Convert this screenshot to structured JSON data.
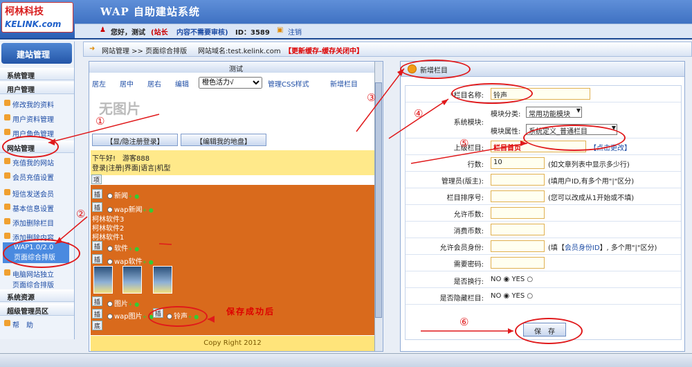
{
  "header": {
    "logo_cn": "柯林科技",
    "logo_en": "KELINK.com",
    "title": "WAP 自助建站系统"
  },
  "userbar": {
    "greeting": "您好，测试",
    "role": "(站长",
    "audit": "内容不需要审核)",
    "id_label": "ID：3589",
    "logout": "注销"
  },
  "sidebar": {
    "head": "建站管理",
    "cats": [
      "系统管理",
      "用户管理",
      "网站管理",
      "系统资源",
      "超级管理员区"
    ],
    "user_items": [
      "修改我的资料",
      "用户资料管理",
      "用户角色管理"
    ],
    "site_items": [
      "充值我的网站",
      "会员充值设置",
      "短信发送会员",
      "基本信息设置",
      "添加删除栏目",
      "添加删除内容"
    ],
    "wap_item": [
      "WAP1.0/2.0",
      "页面综合排版"
    ],
    "pc_item": [
      "电脑网站独立",
      "页面综合排版"
    ],
    "help": "帮　助"
  },
  "breadcrumb": {
    "path": "网站管理 >> 页面综合排版",
    "domain": "网站域名:test.kelink.com",
    "refresh": "【更新缓存-缓存关闭中】"
  },
  "left": {
    "title": "测试",
    "tools": [
      "居左",
      "居中",
      "居右",
      "编辑"
    ],
    "style_select": "橙色活力√",
    "manage_css": "管理CSS样式",
    "add_column": "新增栏目",
    "no_image": "无图片",
    "btn_login": "【显/隐注册登录】",
    "btn_edit": "【编辑我的地盘】",
    "greet": "下午好!　游客888",
    "reg_line": "登录|注册|界面|语言|机型",
    "item": "项",
    "insert": "插",
    "bottom": "底",
    "news": "新闻",
    "wap_news": "wap新闻",
    "soft": [
      "柯林软件3",
      "柯林软件2",
      "柯林软件1"
    ],
    "software": "软件",
    "wap_software": "wap软件",
    "pic": "图片",
    "wap_pic": "wap图片",
    "ringtone": "铃声",
    "saved_note": "保存成功后",
    "copyright": "Copy Right 2012"
  },
  "right": {
    "title": "新增栏目",
    "name_label": "*栏目名称:",
    "name_value": "铃声",
    "module_label": "系统模块:",
    "cat_label": "模块分类:",
    "cat_value": "常用功能模块",
    "attr_label": "模块属性:",
    "attr_value": "系统定义_普通栏目",
    "parent_label": "上级栏目:",
    "parent_value": "栏目首页",
    "parent_link": "【点击更改】",
    "rows_label": "行数:",
    "rows_value": "10",
    "rows_hint": "(如文章列表中显示多少行)",
    "admin_label": "管理员(版主):",
    "admin_hint": "(填用户ID,有多个用\"|\"区分)",
    "order_label": "栏目排序号:",
    "order_hint": "(您可以改成从1开始或不填)",
    "coin_label": "允许币数:",
    "spend_label": "消费币数:",
    "member_label": "允许会员身份:",
    "member_hint_a": "(填【",
    "member_hint_link": "会员身份ID",
    "member_hint_b": "】, 多个用\"|\"区分)",
    "pwd_label": "需要密码:",
    "wrap_label": "是否换行:",
    "hide_label": "是否隐藏栏目:",
    "no": "NO",
    "yes": "YES",
    "save": "保　存"
  },
  "annotations": [
    "①",
    "②",
    "③",
    "④",
    "⑤",
    "⑥"
  ]
}
